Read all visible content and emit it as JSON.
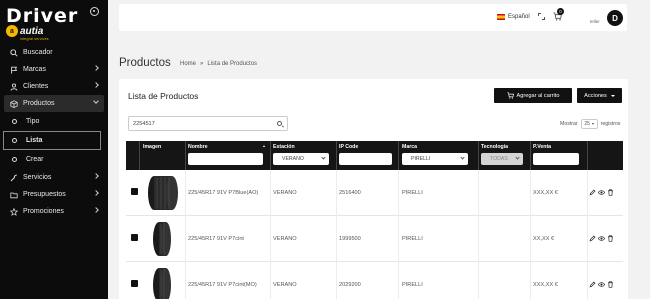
{
  "brand": {
    "name": "Driver",
    "sub": "autia",
    "tagline": "integral services"
  },
  "sidebar": {
    "items": [
      {
        "label": "Buscador",
        "icon": "search-icon"
      },
      {
        "label": "Marcas",
        "icon": "flag-icon"
      },
      {
        "label": "Clientes",
        "icon": "user-icon"
      },
      {
        "label": "Productos",
        "icon": "box-icon"
      },
      {
        "label": "Servicios",
        "icon": "wrench-icon"
      },
      {
        "label": "Presupuestos",
        "icon": "folder-icon"
      },
      {
        "label": "Promociones",
        "icon": "star-icon"
      }
    ],
    "subitems": [
      {
        "label": "Tipo"
      },
      {
        "label": "Lista"
      },
      {
        "label": "Crear"
      }
    ]
  },
  "topbar": {
    "language": "Español",
    "cart_count": "0",
    "user_name": "teller",
    "avatar_letter": "D"
  },
  "page": {
    "title": "Productos",
    "breadcrumb": [
      "Home",
      "»",
      "Lista de Productos"
    ]
  },
  "card": {
    "title": "Lista de Productos",
    "add_to_cart": "Agregar al carrito",
    "actions": "Acciones",
    "search_value": "2254517",
    "show_label": "Mostrar",
    "show_value": "25",
    "records_label": "registros"
  },
  "table": {
    "headers": [
      "Imagen",
      "Nombre",
      "Estación",
      "IP Code",
      "Marca",
      "Tecnología",
      "P.Venta"
    ],
    "filters": {
      "estacion": "VERANO",
      "marca": "PIRELLI",
      "tecnologia": "TODAS"
    },
    "rows": [
      {
        "name": "225/45R17 91V P7Blue(AO)",
        "season": "VERANO",
        "ip": "2516400",
        "brand": "PIRELLI",
        "tech": "",
        "price": "XXX,XX €"
      },
      {
        "name": "225/45R17 91V P7cint",
        "season": "VERANO",
        "ip": "1999500",
        "brand": "PIRELLI",
        "tech": "",
        "price": "XX,XX €"
      },
      {
        "name": "225/45R17 91V P7cint(MO)",
        "season": "VERANO",
        "ip": "2029200",
        "brand": "PIRELLI",
        "tech": "",
        "price": "XXX,XX €"
      }
    ]
  },
  "colors": {
    "sidebar_bg": "#0c0c0c",
    "accent": "#f5b800",
    "header_bg": "#151515"
  }
}
